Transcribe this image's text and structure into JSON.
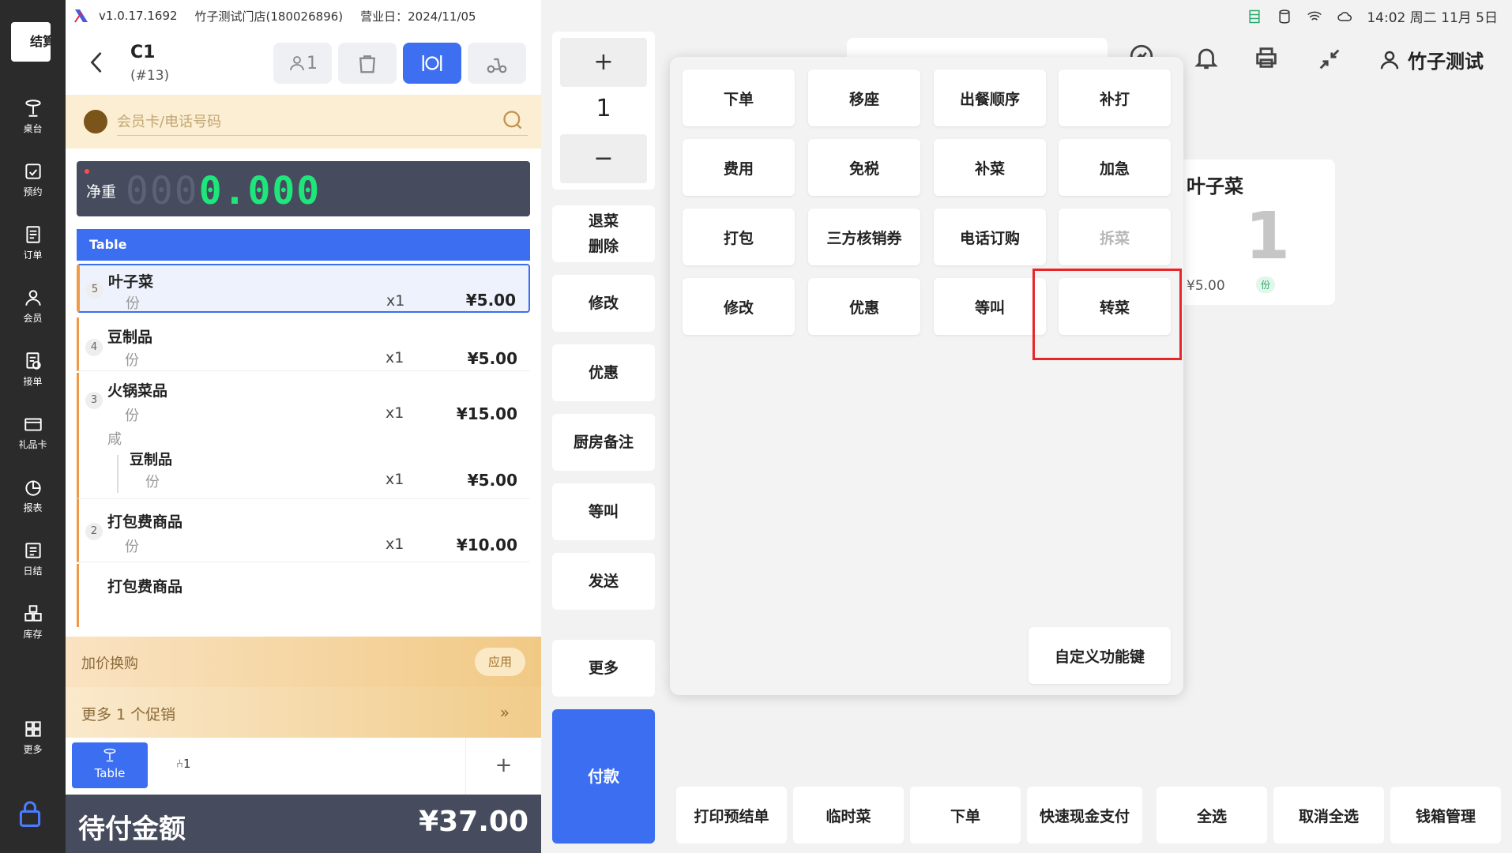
{
  "topbar": {
    "version": "v1.0.17.1692",
    "store": "竹子测试门店(180026896)",
    "business_day": "营业日：2024/11/05"
  },
  "nav": {
    "logo_text": "结算",
    "items": [
      {
        "label": "桌台",
        "icon": "dining-table-icon"
      },
      {
        "label": "预约",
        "icon": "calendar-check-icon"
      },
      {
        "label": "订单",
        "icon": "order-list-icon"
      },
      {
        "label": "会员",
        "icon": "person-icon"
      },
      {
        "label": "接单",
        "icon": "receive-order-icon"
      },
      {
        "label": "礼品卡",
        "icon": "gift-card-icon"
      },
      {
        "label": "报表",
        "icon": "pie-chart-icon"
      },
      {
        "label": "日结",
        "icon": "daily-close-icon"
      },
      {
        "label": "库存",
        "icon": "boxes-icon"
      },
      {
        "label": "更多",
        "icon": "grid-icon"
      }
    ]
  },
  "order": {
    "table_name": "C1",
    "order_no": "(#13)",
    "guests": "1",
    "member_placeholder": "会员卡/电话号码",
    "scale_label": "净重",
    "scale_value": "0.000",
    "scale_ghost": "000",
    "table_band": "Table",
    "items": [
      {
        "idx": "5",
        "name": "叶子菜",
        "unit": "份",
        "qty": "x1",
        "price": "¥5.00"
      },
      {
        "idx": "4",
        "name": "豆制品",
        "unit": "份",
        "qty": "x1",
        "price": "¥5.00"
      },
      {
        "idx": "3",
        "name": "火锅菜品",
        "unit": "份",
        "qty": "x1",
        "price": "¥15.00",
        "note": "咸",
        "sub_name": "豆制品",
        "sub_unit": "份",
        "sub_qty": "x1",
        "sub_price": "¥5.00"
      },
      {
        "idx": "2",
        "name": "打包费商品",
        "unit": "份",
        "qty": "x1",
        "price": "¥10.00"
      },
      {
        "name": "打包费商品"
      }
    ],
    "promo_label": "加价换购",
    "promo_apply": "应用",
    "more_promo": "更多 1 个促销",
    "seat_tab": "Table",
    "seat_count": "1",
    "total_label": "待付金额",
    "total_amount": "¥37.00"
  },
  "qty": {
    "plus": "+",
    "value": "1",
    "minus": "−"
  },
  "mid_buttons": {
    "return_line1": "退菜",
    "return_line2": "删除",
    "modify": "修改",
    "discount": "优惠",
    "kitchen_note": "厨房备注",
    "wait_call": "等叫",
    "send": "发送",
    "more": "更多",
    "pay": "付款"
  },
  "popover": {
    "buttons": [
      {
        "label": "下单"
      },
      {
        "label": "移座"
      },
      {
        "label": "出餐顺序"
      },
      {
        "label": "补打"
      },
      {
        "label": "费用"
      },
      {
        "label": "免税"
      },
      {
        "label": "补菜"
      },
      {
        "label": "加急"
      },
      {
        "label": "打包"
      },
      {
        "label": "三方核销券"
      },
      {
        "label": "电话订购"
      },
      {
        "label": "拆菜",
        "disabled": true
      },
      {
        "label": "修改"
      },
      {
        "label": "优惠"
      },
      {
        "label": "等叫"
      },
      {
        "label": "转菜"
      }
    ],
    "custom_key": "自定义功能键"
  },
  "status": {
    "time": "14:02 周二 11月 5日"
  },
  "user": {
    "name": "竹子测试"
  },
  "bg_card": {
    "name": "叶子菜",
    "qty": "1",
    "price": "¥5.00",
    "unit": "份"
  },
  "bottom_bar": [
    "打印预结单",
    "临时菜",
    "下单",
    "快速现金支付",
    "全选",
    "取消全选",
    "钱箱管理"
  ],
  "colors": {
    "accent": "#3b6ef0",
    "highlight": "#e8262a",
    "scale_digits": "#1fe67a",
    "promo": "#f1c985"
  }
}
